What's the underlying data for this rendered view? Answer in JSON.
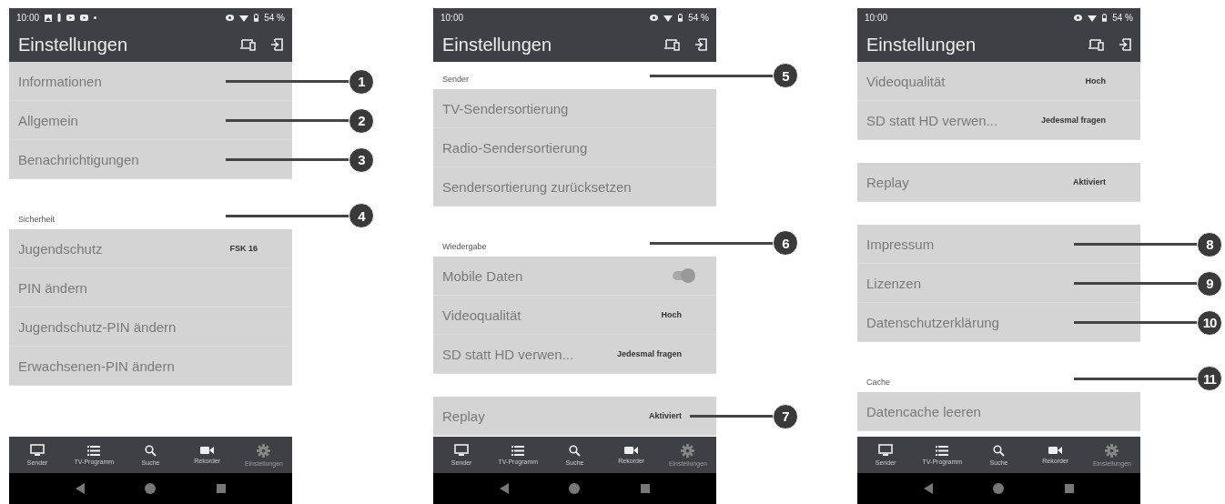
{
  "screens": [
    {
      "status_bar": {
        "time": "10:00",
        "notification_icons": true,
        "battery": "54 %"
      },
      "app_bar": {
        "title": "Einstellungen"
      },
      "sections": [
        {
          "items": [
            {
              "kind": "link",
              "label": "Informationen",
              "callout": "1"
            },
            {
              "kind": "link",
              "label": "Allgemein",
              "callout": "2"
            },
            {
              "kind": "link",
              "label": "Benachrichtigungen",
              "callout": "3"
            }
          ]
        },
        {
          "header": "Sicherheit",
          "callout": "4",
          "items": [
            {
              "kind": "value",
              "label": "Jugendschutz",
              "value": "FSK 16"
            },
            {
              "kind": "link",
              "label": "PIN ändern"
            },
            {
              "kind": "link",
              "label": "Jugendschutz-PIN ändern"
            },
            {
              "kind": "link",
              "label": "Erwachsenen-PIN ändern"
            }
          ]
        }
      ],
      "bottom_nav": [
        {
          "label": "Sender",
          "selected": false
        },
        {
          "label": "TV-Programm",
          "selected": false
        },
        {
          "label": "Suche",
          "selected": false
        },
        {
          "label": "Rekorder",
          "selected": false
        },
        {
          "label": "Einstellungen",
          "selected": true
        }
      ]
    },
    {
      "status_bar": {
        "time": "10:00",
        "notification_icons": false,
        "battery": "54 %"
      },
      "app_bar": {
        "title": "Einstellungen"
      },
      "sections": [
        {
          "header": "Sender",
          "callout": "5",
          "items": [
            {
              "kind": "link",
              "label": "TV-Sendersortierung"
            },
            {
              "kind": "link",
              "label": "Radio-Sendersortierung"
            },
            {
              "kind": "link",
              "label": "Sendersortierung zurücksetzen"
            }
          ]
        },
        {
          "header": "Wiedergabe",
          "callout": "6",
          "items": [
            {
              "kind": "toggle",
              "label": "Mobile Daten",
              "on": true
            },
            {
              "kind": "value",
              "label": "Videoqualität",
              "value": "Hoch"
            },
            {
              "kind": "value",
              "label": "SD statt HD verwen...",
              "value": "Jedesmal fragen"
            }
          ]
        },
        {
          "items": [
            {
              "kind": "value",
              "label": "Replay",
              "value": "Aktiviert",
              "callout": "7"
            }
          ]
        }
      ],
      "bottom_nav": [
        {
          "label": "Sender",
          "selected": false
        },
        {
          "label": "TV-Programm",
          "selected": false
        },
        {
          "label": "Suche",
          "selected": false
        },
        {
          "label": "Rekorder",
          "selected": false
        },
        {
          "label": "Einstellungen",
          "selected": true
        }
      ]
    },
    {
      "status_bar": {
        "time": "10:00",
        "notification_icons": false,
        "battery": "54 %"
      },
      "app_bar": {
        "title": "Einstellungen"
      },
      "sections": [
        {
          "items": [
            {
              "kind": "value",
              "label": "Videoqualität",
              "value": "Hoch"
            },
            {
              "kind": "value",
              "label": "SD statt HD verwen...",
              "value": "Jedesmal fragen"
            }
          ]
        },
        {
          "items": [
            {
              "kind": "value",
              "label": "Replay",
              "value": "Aktiviert"
            }
          ]
        },
        {
          "items": [
            {
              "kind": "link",
              "label": "Impressum",
              "callout": "8"
            },
            {
              "kind": "link",
              "label": "Lizenzen",
              "callout": "9"
            },
            {
              "kind": "link",
              "label": "Datenschutzerklärung",
              "callout": "10"
            }
          ]
        },
        {
          "header": "Cache",
          "callout": "11",
          "items": [
            {
              "kind": "link",
              "label": "Datencache leeren"
            }
          ]
        }
      ],
      "bottom_nav": [
        {
          "label": "Sender",
          "selected": false
        },
        {
          "label": "TV-Programm",
          "selected": false
        },
        {
          "label": "Suche",
          "selected": false
        },
        {
          "label": "Rekorder",
          "selected": false
        },
        {
          "label": "Einstellungen",
          "selected": true
        }
      ]
    }
  ]
}
